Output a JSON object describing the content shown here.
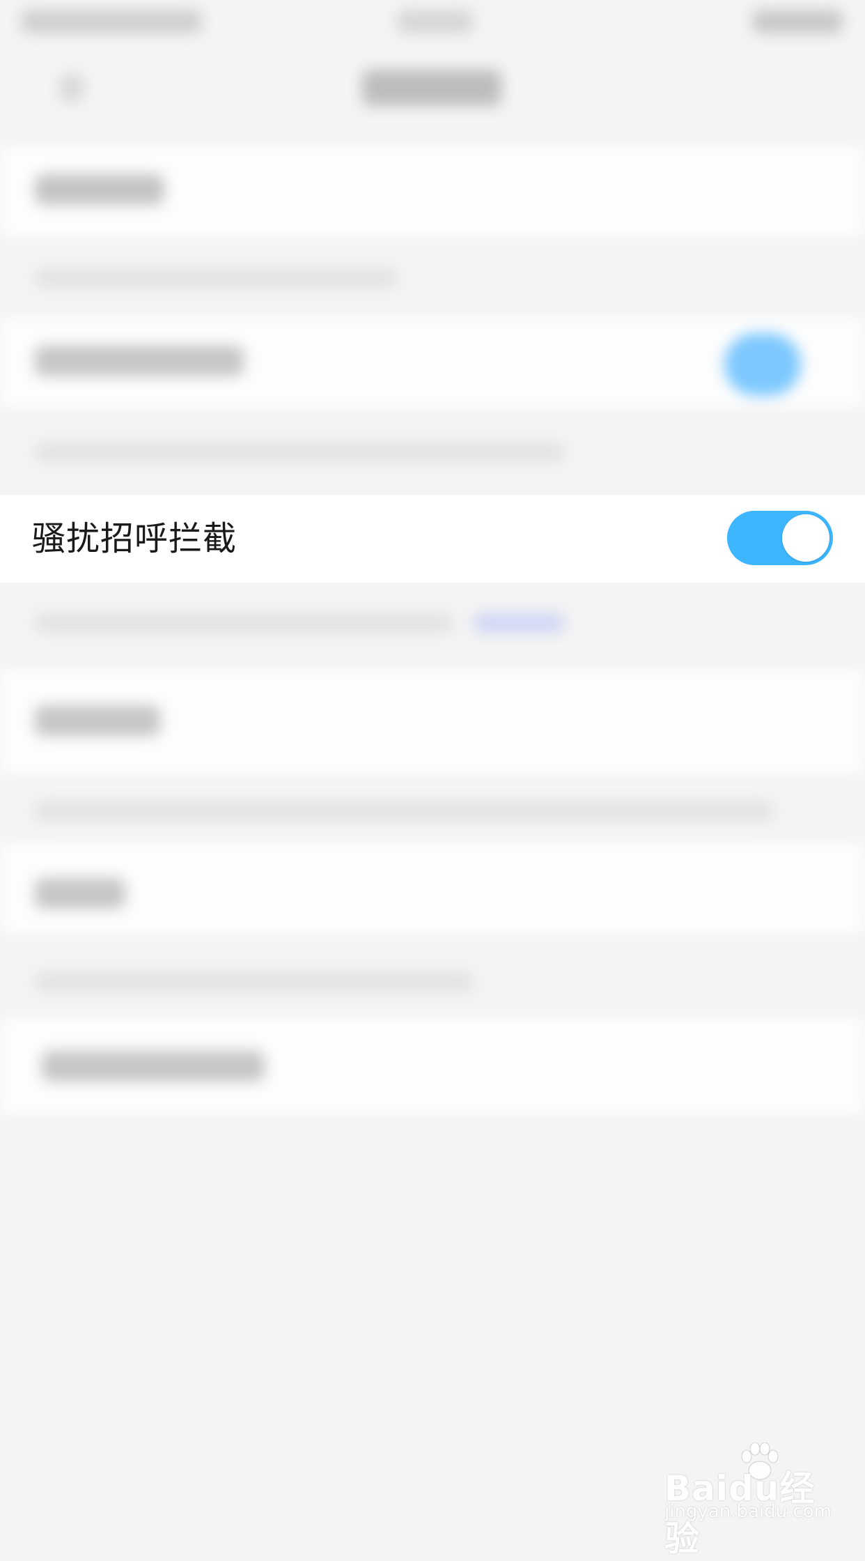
{
  "setting": {
    "label": "骚扰招呼拦截",
    "enabled": true
  },
  "colors": {
    "accent": "#3db5ff",
    "background": "#f4f4f4"
  },
  "watermark": {
    "logo": "Baidu经验",
    "url": "jingyan.baidu.com"
  }
}
